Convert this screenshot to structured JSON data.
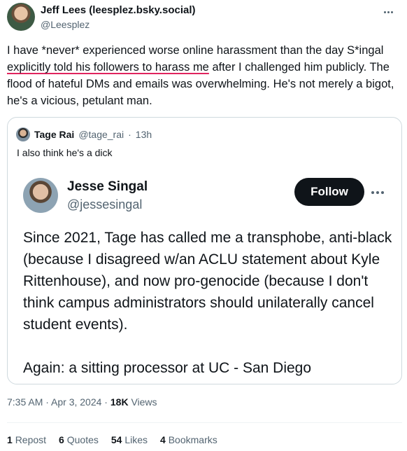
{
  "tweet": {
    "author_name": "Jeff Lees (leesplez.bsky.social)",
    "author_handle": "@Leesplez",
    "text_part1": "I have *never* experienced worse online harassment than the day S*ingal ",
    "text_underlined": "explicitly told his followers to harass me",
    "text_part2": " after I challenged him publicly. The flood of hateful DMs and emails was overwhelming. He's not merely a bigot, he's a vicious, petulant man."
  },
  "quote": {
    "name": "Tage Rai",
    "handle": "@tage_rai",
    "dot": "·",
    "time": "13h",
    "text": "I also think he's a dick"
  },
  "screenshot": {
    "name": "Jesse Singal",
    "handle": "@jessesingal",
    "follow_label": "Follow",
    "paragraph1": "Since 2021, Tage has called me a transphobe, anti-black (because I disagreed w/an ACLU statement about Kyle Rittenhouse), and now pro-genocide (because I don't think campus administrators should unilaterally cancel student events).",
    "paragraph2": "Again: a sitting processor at UC - San Diego"
  },
  "meta": {
    "time": "7:35 AM · Apr 3, 2024",
    "dot": " · ",
    "views_count": "18K",
    "views_label": "Views"
  },
  "stats": [
    {
      "count": "1",
      "label": "Repost"
    },
    {
      "count": "6",
      "label": "Quotes"
    },
    {
      "count": "54",
      "label": "Likes"
    },
    {
      "count": "4",
      "label": "Bookmarks"
    }
  ],
  "icons": {
    "more": "more-horizontal-icon"
  }
}
